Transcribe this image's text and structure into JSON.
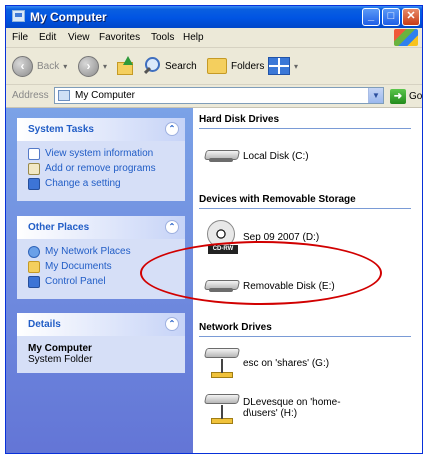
{
  "window": {
    "title": "My Computer"
  },
  "title_buttons": {
    "minimize": "_",
    "maximize": "□",
    "close": "✕"
  },
  "menu": [
    "File",
    "Edit",
    "View",
    "Favorites",
    "Tools",
    "Help"
  ],
  "toolbar": {
    "back_label": "Back",
    "search_label": "Search",
    "folders_label": "Folders"
  },
  "address": {
    "label": "Address",
    "value": "My Computer",
    "go_label": "Go"
  },
  "left_pane": {
    "system_tasks": {
      "title": "System Tasks",
      "items": [
        "View system information",
        "Add or remove programs",
        "Change a setting"
      ]
    },
    "other_places": {
      "title": "Other Places",
      "items": [
        "My Network Places",
        "My Documents",
        "Control Panel"
      ]
    },
    "details": {
      "title": "Details",
      "name": "My Computer",
      "type": "System Folder"
    }
  },
  "content": {
    "hard_disk": {
      "title": "Hard Disk Drives",
      "items": [
        "Local Disk (C:)"
      ]
    },
    "removable": {
      "title": "Devices with Removable Storage",
      "items": [
        "Sep 09 2007 (D:)",
        "Removable Disk (E:)"
      ],
      "cd_badge": "CD-RW"
    },
    "network": {
      "title": "Network Drives",
      "items": [
        "esc on 'shares' (G:)",
        "DLevesque on 'home-d\\users' (H:)"
      ]
    }
  },
  "colors": {
    "titlebar": "#0054e3",
    "task_pane": "#6b8fe3",
    "link": "#215dc6",
    "annotation": "#d10000"
  },
  "icons": [
    "my-computer-icon",
    "back-icon",
    "forward-icon",
    "up-folder-icon",
    "search-icon",
    "folders-icon",
    "views-icon",
    "go-icon",
    "disk-icon",
    "cd-drive-icon",
    "network-drive-icon",
    "windows-logo-icon"
  ]
}
